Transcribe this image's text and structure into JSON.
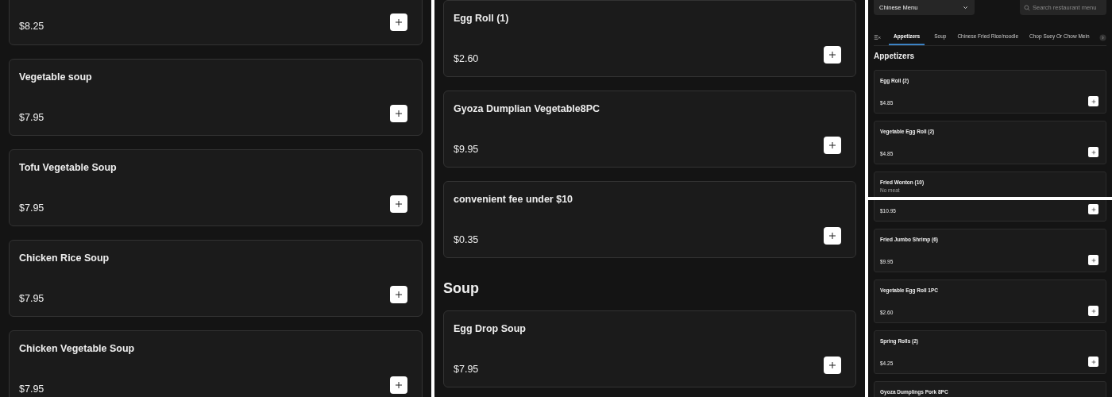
{
  "left_panel": {
    "items": [
      {
        "kind": "item",
        "price": "$8.25"
      },
      {
        "kind": "item",
        "name": "Vegetable soup",
        "price": "$7.95"
      },
      {
        "kind": "item",
        "name": "Tofu Vegetable Soup",
        "price": "$7.95"
      },
      {
        "kind": "item",
        "name": "Chicken Rice Soup",
        "price": "$7.95"
      },
      {
        "kind": "item",
        "name": "Chicken Vegetable Soup",
        "price": "$7.95"
      }
    ]
  },
  "middle_panel": {
    "items": [
      {
        "kind": "item",
        "name": "Egg Roll (1)",
        "price": "$2.60"
      },
      {
        "kind": "item",
        "name": "Gyoza Dumplian Vegetable8PC",
        "price": "$9.95"
      },
      {
        "kind": "item",
        "name": "convenient fee under $10",
        "price": "$0.35"
      },
      {
        "kind": "heading",
        "text": "Soup"
      },
      {
        "kind": "item",
        "name": "Egg Drop Soup",
        "price": "$7.95"
      }
    ]
  },
  "mobile_top": {
    "menu_select": "Chinese Menu",
    "search": {
      "placeholder": "Search restaurant menu"
    },
    "tabs": [
      {
        "label": "Appetizers",
        "selected": true
      },
      {
        "label": "Soup",
        "selected": false
      },
      {
        "label": "Chinese Fried Rice/noodle",
        "selected": false
      },
      {
        "label": "Chop Suey Or Chow Mein",
        "selected": false
      }
    ],
    "heading": "Appetizers",
    "items": [
      {
        "name": "Egg Roll (2)",
        "price": "$4.85"
      },
      {
        "name": "Vegetable Egg Roll (2)",
        "price": "$4.85"
      },
      {
        "name": "Fried Wonton (10)",
        "description": "No meat"
      }
    ]
  },
  "mobile_bottom": {
    "items": [
      {
        "price": "$10.95"
      },
      {
        "name": "Fried Jumbo Shrimp (6)",
        "price": "$9.95"
      },
      {
        "name": "Vegetable Egg Roll 1PC",
        "price": "$2.60"
      },
      {
        "name": "Spring Rolls (2)",
        "price": "$4.25"
      },
      {
        "name": "Gyoza Dumplings Pork 8PC"
      }
    ]
  }
}
